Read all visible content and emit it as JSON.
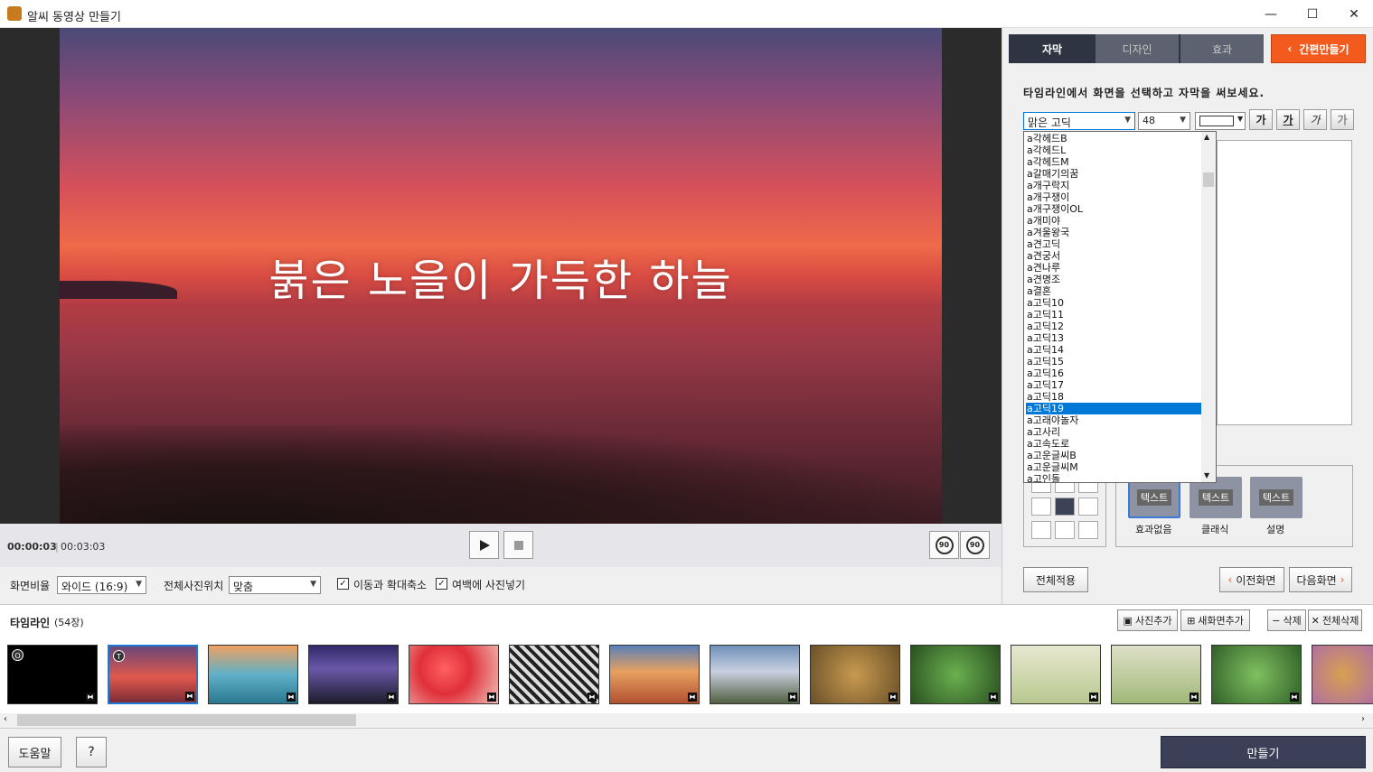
{
  "window": {
    "title": "알씨 동영상 만들기",
    "minimize": "—",
    "maximize": "☐",
    "close": "✕"
  },
  "preview": {
    "caption": "붉은 노을이 가득한 하늘"
  },
  "playback": {
    "current_time": "00:00:03",
    "total_time": "00:03:03",
    "rotate_left": "90",
    "rotate_right": "90"
  },
  "options": {
    "ratio_label": "화면비율",
    "ratio_value": "와이드 (16:9)",
    "position_label": "전체사진위치",
    "position_value": "맞춤",
    "pan_zoom_label": "이동과 확대축소",
    "pan_zoom_checked": true,
    "fill_margin_label": "여백에 사진넣기",
    "fill_margin_checked": true
  },
  "tabs": [
    {
      "label": "자막",
      "active": true
    },
    {
      "label": "디자인",
      "active": false
    },
    {
      "label": "효과",
      "active": false
    }
  ],
  "quick_make": "간편만들기",
  "subtitle": {
    "instruction": "타임라인에서 화면을 선택하고 자막을 써보세요.",
    "font": "맑은 고딕",
    "size": "48",
    "style_buttons": [
      "가",
      "가",
      "가",
      "가"
    ],
    "font_list": [
      "a각헤드B",
      "a각헤드L",
      "a각헤드M",
      "a갈매기의꿈",
      "a개구락지",
      "a개구쟁이",
      "a개구쟁이OL",
      "a개미야",
      "a겨울왕국",
      "a견고딕",
      "a견궁서",
      "a견나루",
      "a견명조",
      "a결혼",
      "a고딕10",
      "a고딕11",
      "a고딕12",
      "a고딕13",
      "a고딕14",
      "a고딕15",
      "a고딕16",
      "a고딕17",
      "a고딕18",
      "a고딕19",
      "a고래야놀자",
      "a고사리",
      "a고속도로",
      "a고운글씨B",
      "a고운글씨M",
      "a고인돌"
    ],
    "selected_font": "a고딕19"
  },
  "effects": [
    {
      "tag": "텍스트",
      "label": "효과없음"
    },
    {
      "tag": "텍스트",
      "label": "클래식"
    },
    {
      "tag": "텍스트",
      "label": "설명"
    }
  ],
  "actions": {
    "apply_all": "전체적용",
    "prev": "이전화면",
    "next": "다음화면"
  },
  "timeline": {
    "title": "타임라인",
    "count": "(54장)",
    "add_photo": "사진추가",
    "add_new_screen": "새화면추가",
    "delete": "삭제",
    "delete_all": "전체삭제"
  },
  "bottom": {
    "help": "도움말",
    "question": "?",
    "make": "만들기"
  },
  "colors": {
    "accent": "#f25a1e",
    "dark_tab": "#2e3442",
    "make_button": "#3b4058",
    "selection": "#0078d7"
  }
}
